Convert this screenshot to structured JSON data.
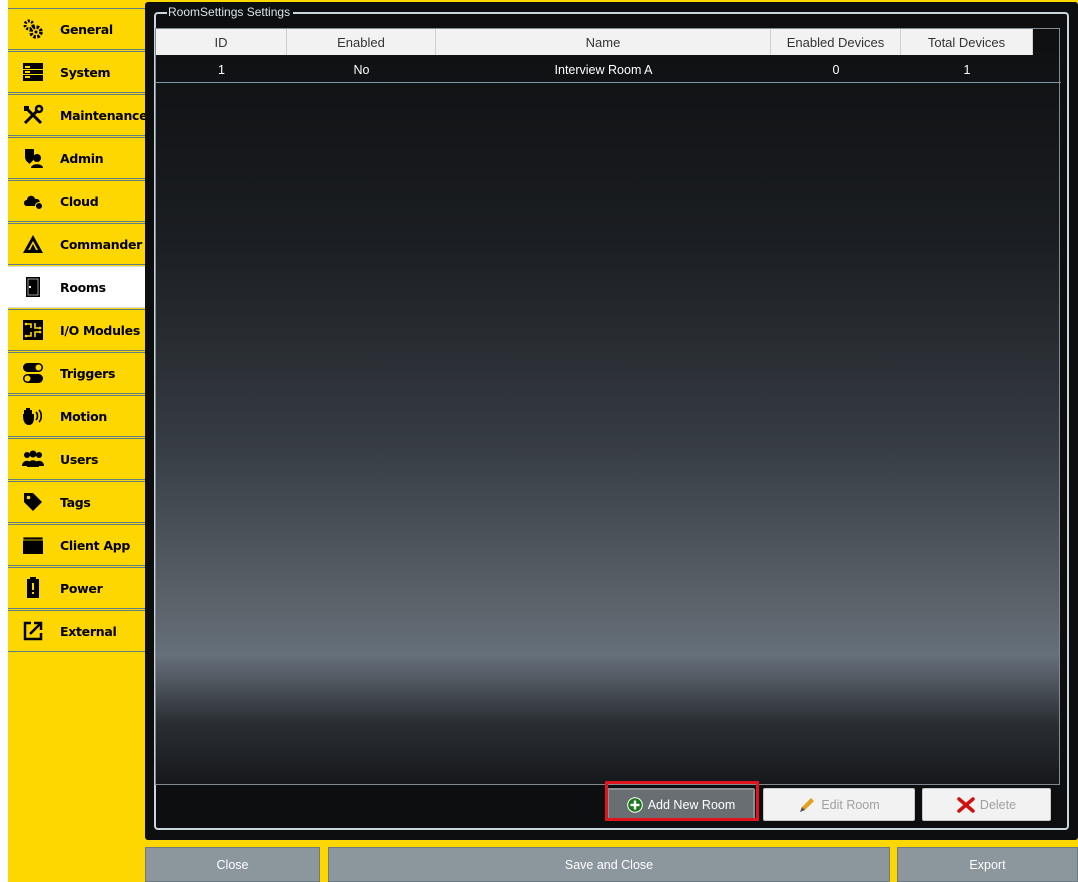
{
  "sidebar": {
    "items": [
      {
        "label": "General",
        "icon": "gears-icon",
        "active": false
      },
      {
        "label": "System",
        "icon": "server-icon",
        "active": false
      },
      {
        "label": "Maintenance",
        "icon": "tools-icon",
        "active": false
      },
      {
        "label": "Admin",
        "icon": "admin-shield-icon",
        "active": false
      },
      {
        "label": "Cloud",
        "icon": "cloud-icon",
        "active": false
      },
      {
        "label": "Commander",
        "icon": "commander-logo-icon",
        "active": false
      },
      {
        "label": "Rooms",
        "icon": "door-icon",
        "active": true
      },
      {
        "label": "I/O Modules",
        "icon": "circuit-icon",
        "active": false
      },
      {
        "label": "Triggers",
        "icon": "toggle-icon",
        "active": false
      },
      {
        "label": "Motion",
        "icon": "hand-wave-icon",
        "active": false
      },
      {
        "label": "Users",
        "icon": "users-icon",
        "active": false
      },
      {
        "label": "Tags",
        "icon": "tag-icon",
        "active": false
      },
      {
        "label": "Client App",
        "icon": "app-window-icon",
        "active": false
      },
      {
        "label": "Power",
        "icon": "battery-icon",
        "active": false
      },
      {
        "label": "External",
        "icon": "external-link-icon",
        "active": false
      }
    ]
  },
  "group": {
    "title": "RoomSettings Settings"
  },
  "table": {
    "columns": [
      "ID",
      "Enabled",
      "Name",
      "Enabled Devices",
      "Total Devices"
    ],
    "rows": [
      {
        "id": "1",
        "enabled": "No",
        "name": "Interview Room A",
        "enabled_devices": "0",
        "total_devices": "1"
      }
    ]
  },
  "actions": {
    "add": "Add New Room",
    "edit": "Edit Room",
    "delete": "Delete"
  },
  "footer": {
    "close": "Close",
    "save_close": "Save and Close",
    "export": "Export"
  },
  "colors": {
    "sidebar_bg": "#ffd700",
    "highlight": "#e0141e",
    "panel_bg": "#0d0e10"
  }
}
